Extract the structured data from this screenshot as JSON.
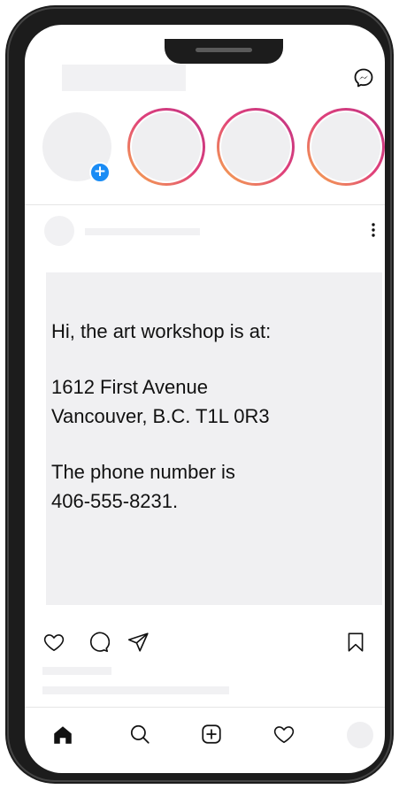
{
  "header": {
    "logo_icon": "logo-placeholder",
    "messenger_icon": "messenger-icon"
  },
  "stories": {
    "count": 4,
    "add_badge_symbol": "+",
    "ring_colors": [
      "#f8b24a",
      "#e0417a",
      "#c13584"
    ],
    "add_badge_color": "#1a8cf5"
  },
  "post": {
    "menu_icon": "more-vertical-icon",
    "lines": [
      "Hi, the art workshop is at:",
      "1612 First Avenue",
      "Vancouver, B.C. T1L 0R3",
      "The phone number is",
      "406-555-8231."
    ],
    "actions": [
      "heart-icon",
      "comment-icon",
      "share-icon",
      "bookmark-icon"
    ]
  },
  "bottom_nav": [
    "home-icon",
    "search-icon",
    "add-post-icon",
    "activity-heart-icon",
    "profile-avatar"
  ]
}
